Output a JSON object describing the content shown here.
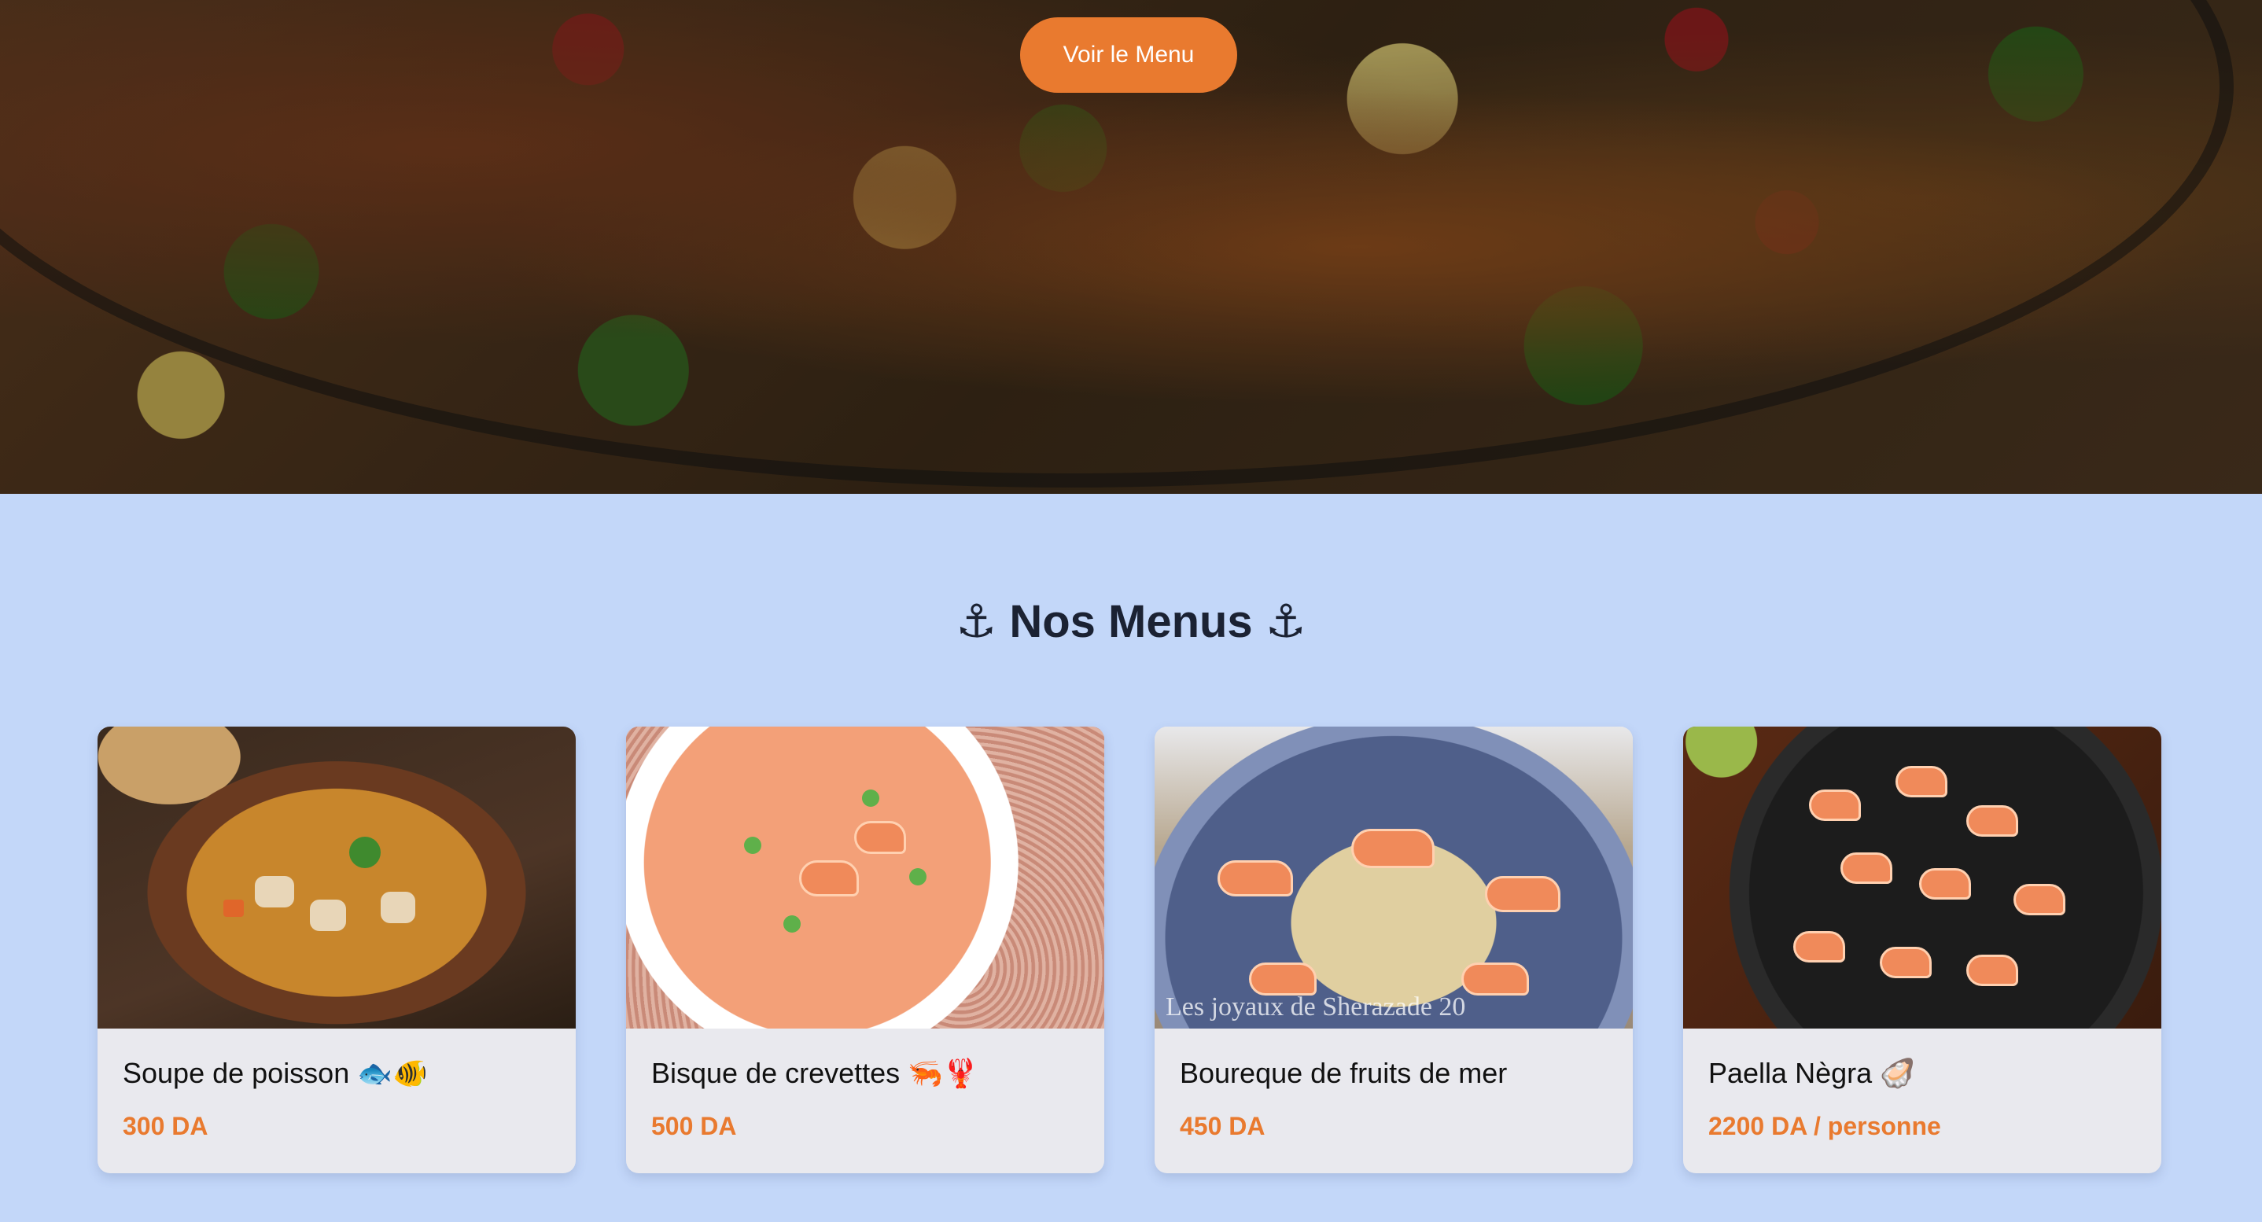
{
  "hero": {
    "button_label": "Voir le Menu"
  },
  "menus": {
    "title": "⚓ Nos Menus ⚓",
    "items": [
      {
        "name": "Soupe de poisson 🐟🐠",
        "price": "300 DA"
      },
      {
        "name": "Bisque de crevettes 🦐🦞",
        "price": "500 DA"
      },
      {
        "name": "Boureque de fruits de mer",
        "price": "450 DA"
      },
      {
        "name": "Paella Nègra 🦪",
        "price": "2200 DA / personne"
      }
    ]
  },
  "images": {
    "boureque_watermark": "Les joyaux de Sherazade 20"
  },
  "colors": {
    "accent": "#e97a2f",
    "section_bg": "#c3d7f9",
    "card_bg": "#e9e9ee",
    "title": "#1b2233"
  }
}
